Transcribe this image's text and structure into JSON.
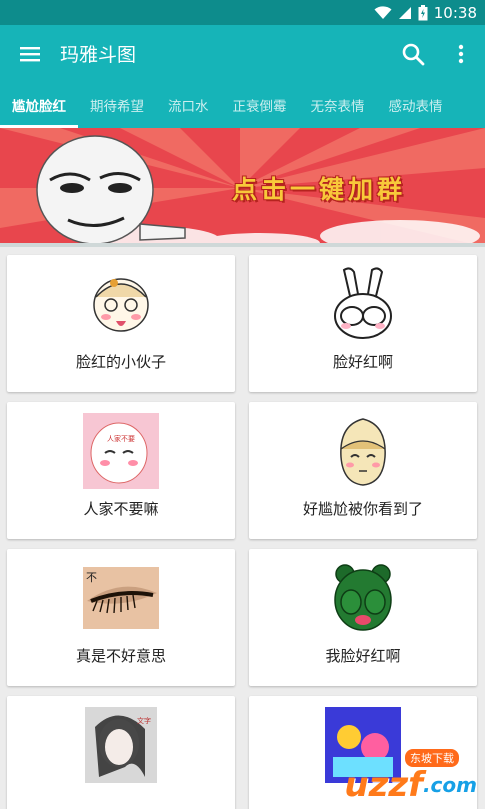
{
  "status": {
    "time": "10:38"
  },
  "app": {
    "title": "玛雅斗图"
  },
  "tabs": [
    "尴尬脸红",
    "期待希望",
    "流口水",
    "正衰倒霉",
    "无奈表情",
    "感动表情"
  ],
  "banner": {
    "text": "点击一键加群"
  },
  "items": [
    {
      "caption": "脸红的小伙子",
      "icon": "blushing-boy"
    },
    {
      "caption": "脸好红啊",
      "icon": "rabbit-covering-face"
    },
    {
      "caption": "人家不要嘛",
      "icon": "shy-bun"
    },
    {
      "caption": "好尴尬被你看到了",
      "icon": "embarrassed-bean"
    },
    {
      "caption": "真是不好意思",
      "icon": "eyelash-closeup"
    },
    {
      "caption": "我脸好红啊",
      "icon": "green-bear"
    },
    {
      "caption": "",
      "icon": "photo-girl"
    },
    {
      "caption": "",
      "icon": "colorful-photo"
    }
  ],
  "watermark": {
    "brand": "uzzf",
    "domain": ".com",
    "tag": "东坡下载"
  },
  "colors": {
    "primary": "#16b4b8",
    "statusbar": "#0d8c8c",
    "banner": "#ea4c52",
    "bannerText": "#f8c93a"
  }
}
